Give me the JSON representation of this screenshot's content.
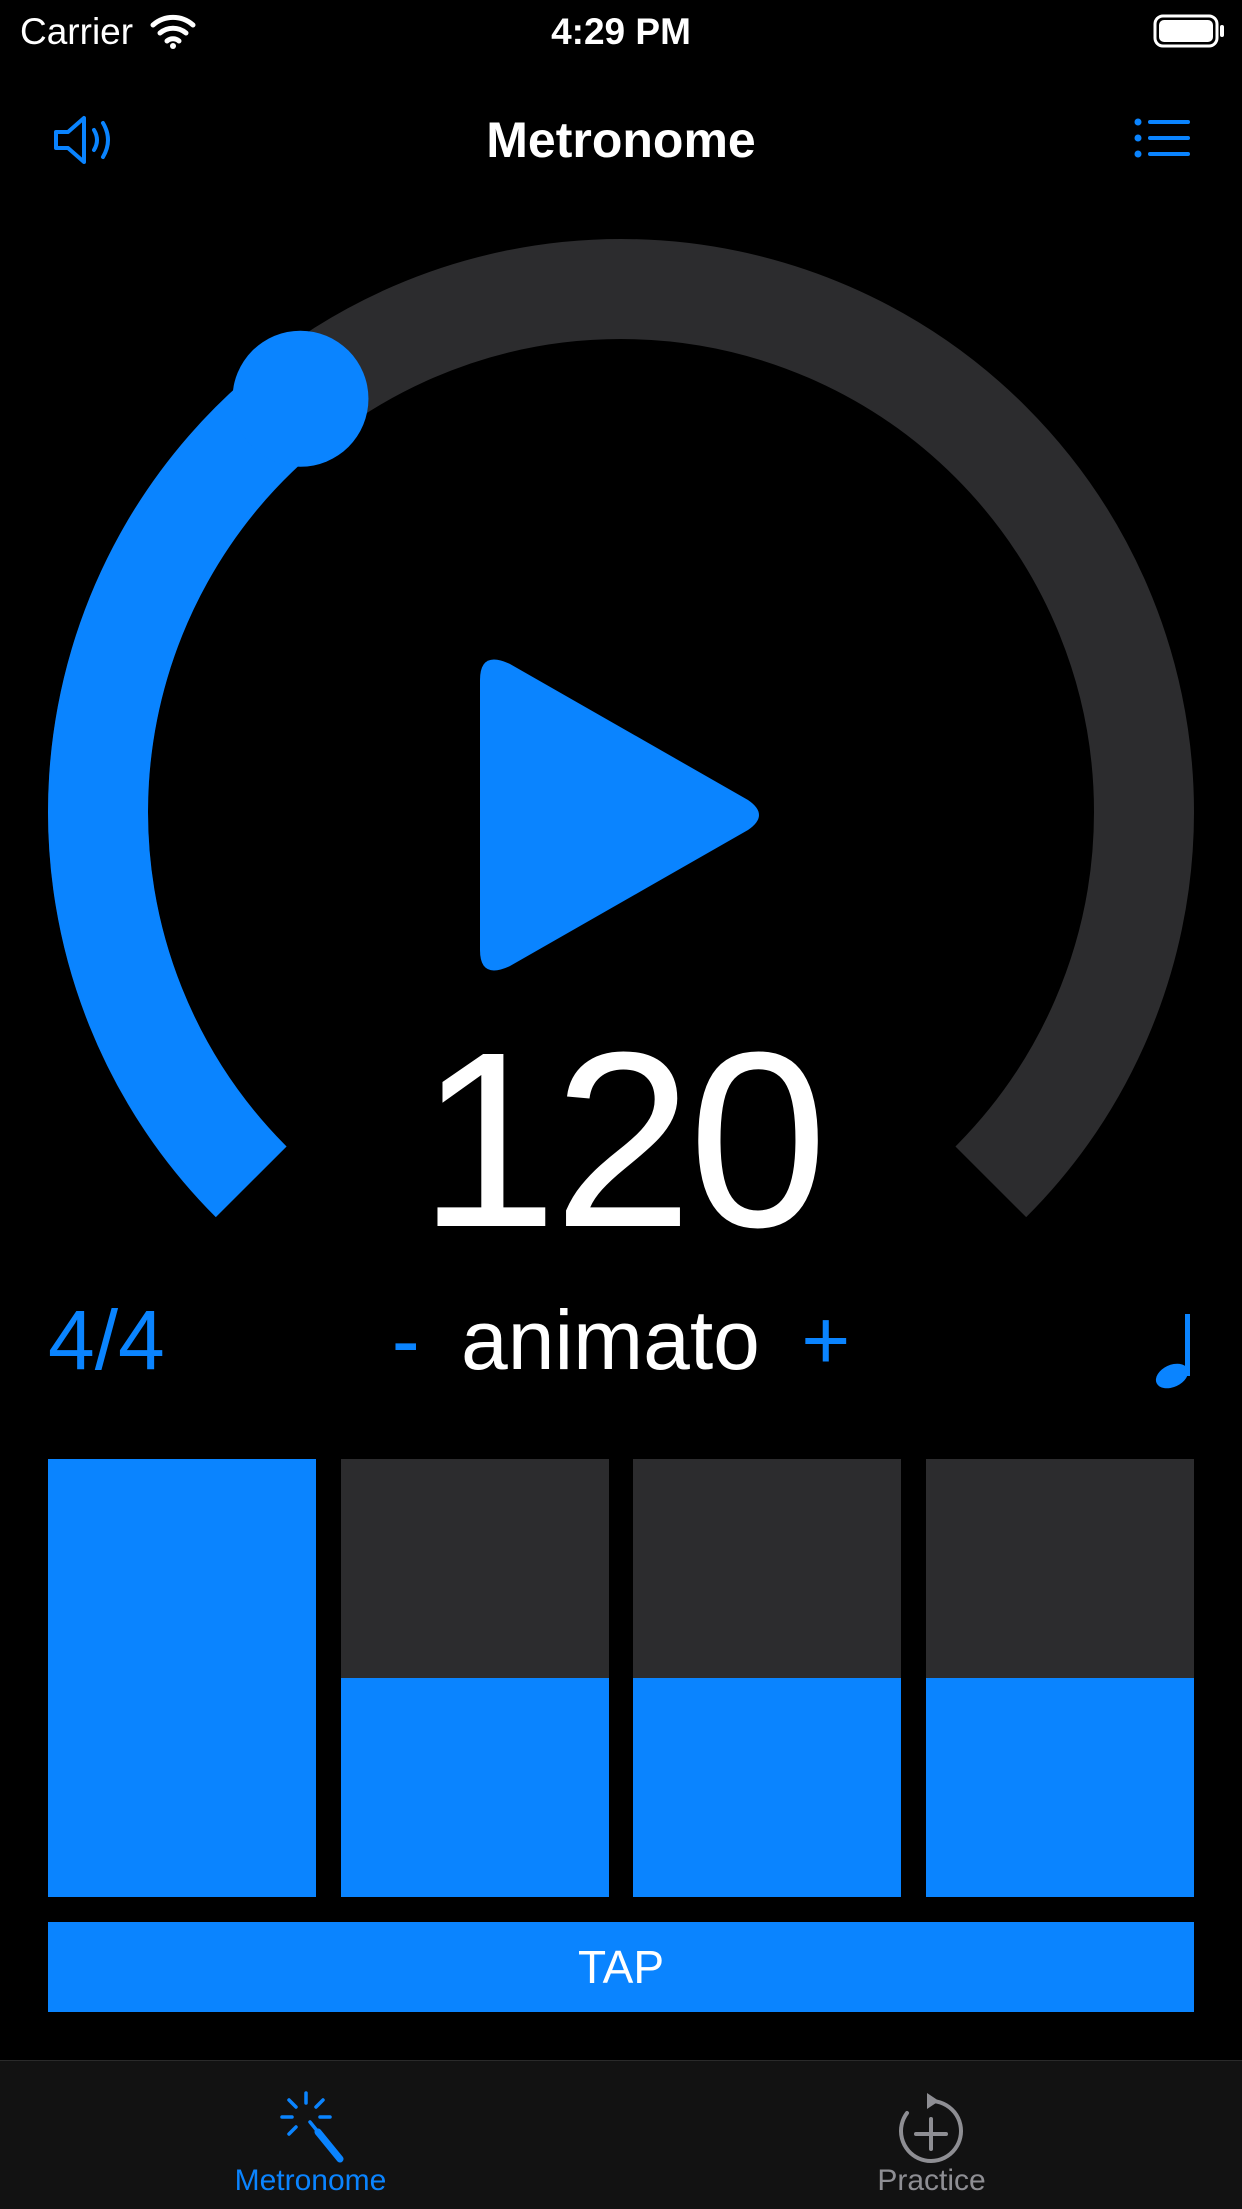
{
  "status_bar": {
    "carrier": "Carrier",
    "time": "4:29 PM"
  },
  "nav": {
    "title": "Metronome",
    "left_icon": "speaker-icon",
    "right_icon": "list-icon"
  },
  "colors": {
    "accent": "#0a84ff",
    "track": "#2c2c2e",
    "background": "#000000",
    "inactive": "#8e8e93"
  },
  "dial": {
    "bpm": "120",
    "level_fraction": 0.36,
    "play_icon": "play-icon"
  },
  "tempo": {
    "time_signature": "4/4",
    "minus": "-",
    "name": "animato",
    "plus": "+",
    "note_icon": "quarter-note-icon"
  },
  "beats": [
    {
      "label": "beat-1",
      "level": 1.0
    },
    {
      "label": "beat-2",
      "level": 0.5
    },
    {
      "label": "beat-3",
      "level": 0.5
    },
    {
      "label": "beat-4",
      "level": 0.5
    }
  ],
  "tap": {
    "label": "TAP"
  },
  "tabs": [
    {
      "label": "Metronome",
      "icon": "magic-wand-icon",
      "active": true
    },
    {
      "label": "Practice",
      "icon": "timer-plus-icon",
      "active": false
    }
  ]
}
